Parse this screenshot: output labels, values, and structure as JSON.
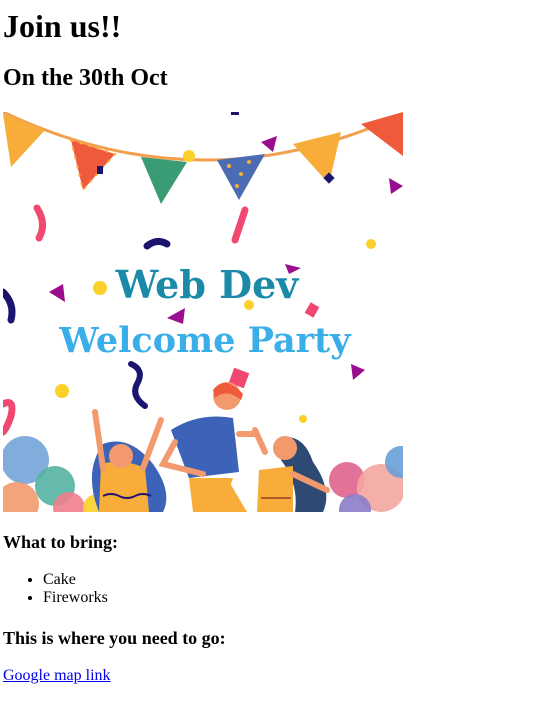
{
  "heading": "Join us!!",
  "subheading": "On the 30th Oct",
  "banner": {
    "line1": "Web Dev",
    "line2": "Welcome Party",
    "colors": {
      "line1": "#1a8aa8",
      "line2": "#39aee8",
      "string": "#f2a04e",
      "flag_orange": "#f8ad3b",
      "flag_red": "#ef5a3a",
      "flag_green": "#3a9c74",
      "flag_blue": "#4a6cb2",
      "confetti_pink": "#f04870",
      "confetti_navy": "#1c1570",
      "confetti_purple": "#9a0d8f",
      "confetti_yellow": "#fbd02a"
    }
  },
  "bring": {
    "heading": "What to bring:",
    "items": [
      "Cake",
      "Fireworks"
    ]
  },
  "destination": {
    "heading": "This is where you need to go:",
    "link_text": "Google map link"
  }
}
